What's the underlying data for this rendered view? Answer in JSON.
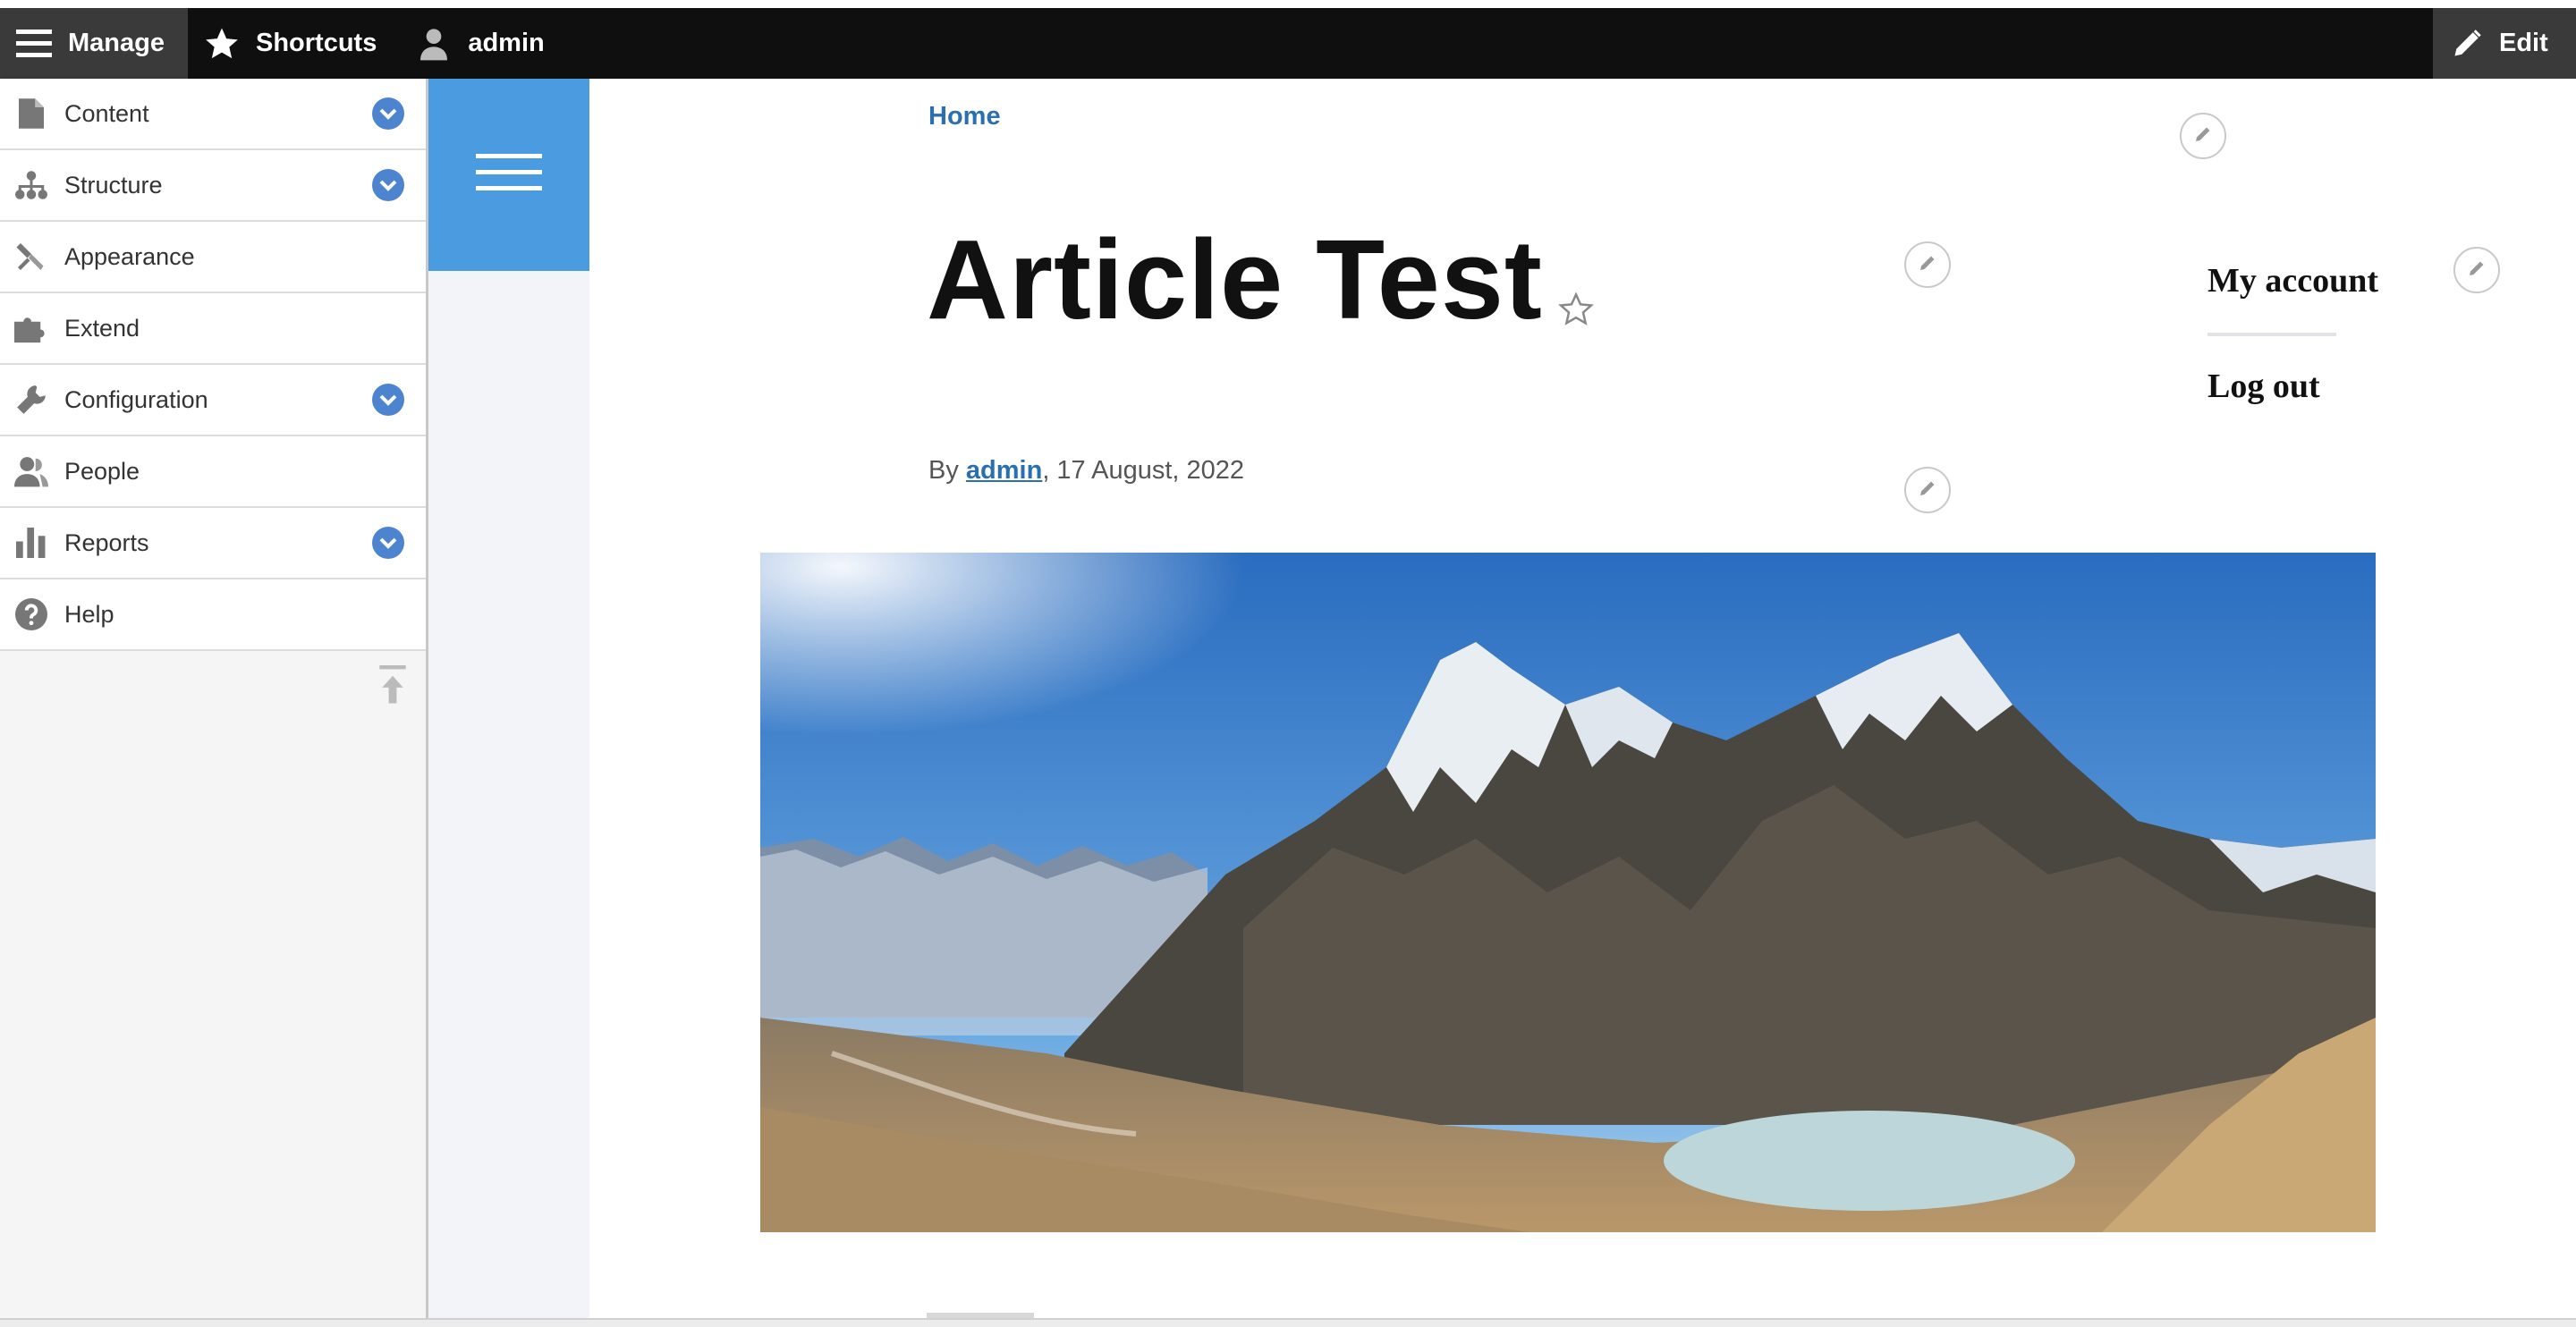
{
  "toolbar": {
    "manage_label": "Manage",
    "shortcuts_label": "Shortcuts",
    "user_label": "admin",
    "edit_label": "Edit"
  },
  "tray": {
    "items": [
      {
        "label": "Content",
        "icon": "file-icon",
        "expandable": true
      },
      {
        "label": "Structure",
        "icon": "sitemap-icon",
        "expandable": true
      },
      {
        "label": "Appearance",
        "icon": "paintbrush-icon",
        "expandable": false
      },
      {
        "label": "Extend",
        "icon": "puzzle-icon",
        "expandable": false
      },
      {
        "label": "Configuration",
        "icon": "wrench-icon",
        "expandable": true
      },
      {
        "label": "People",
        "icon": "people-icon",
        "expandable": false
      },
      {
        "label": "Reports",
        "icon": "bar-chart-icon",
        "expandable": true
      },
      {
        "label": "Help",
        "icon": "help-icon",
        "expandable": false
      }
    ]
  },
  "content": {
    "breadcrumb": "Home",
    "title": "Article Test",
    "byline_prefix": "By ",
    "author": "admin",
    "date": ", 17 August, 2022"
  },
  "account_menu": {
    "my_account": "My account",
    "log_out": "Log out"
  },
  "colors": {
    "toolbar_bg": "#0f0f0f",
    "accent_blue": "#4a9be0",
    "link_blue": "#2a6fb0",
    "expand_blue": "#4c84cf"
  }
}
